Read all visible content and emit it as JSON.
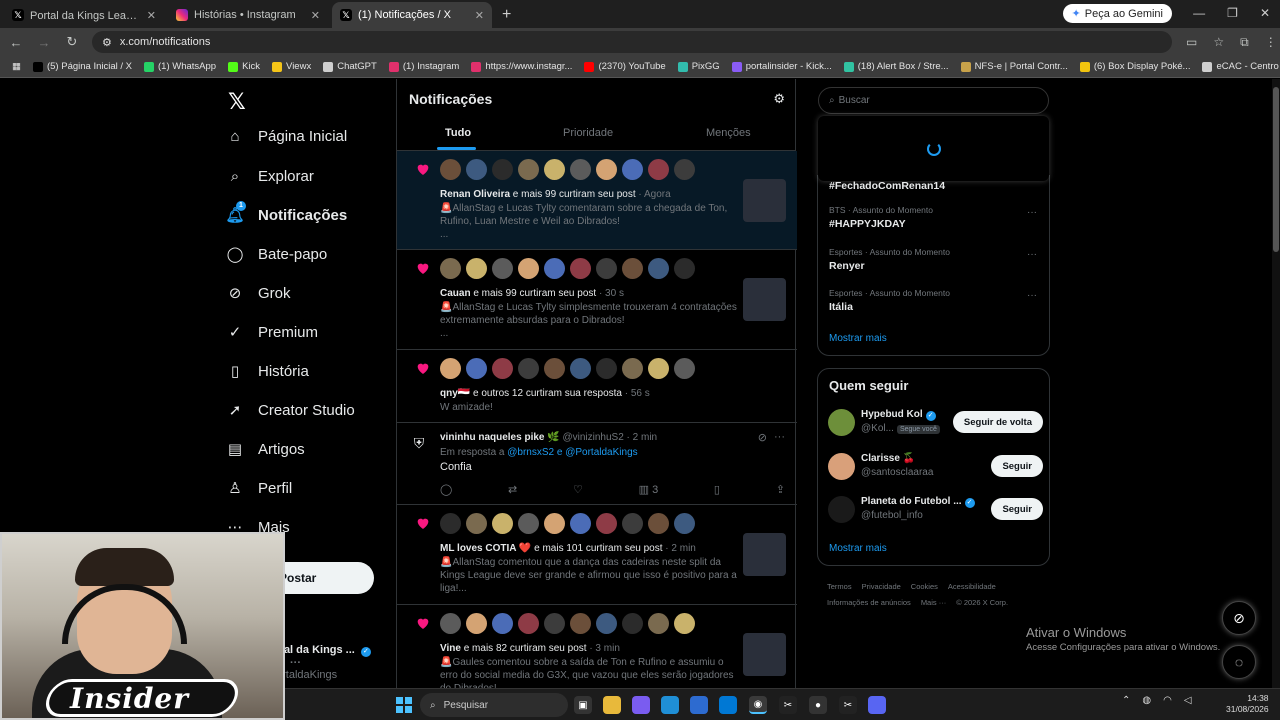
{
  "browser": {
    "tabs": [
      {
        "title": "Portal da Kings League 👑 (@P",
        "icon": "x-icon",
        "active": false
      },
      {
        "title": "Histórias • Instagram",
        "icon": "instagram-icon",
        "active": false
      },
      {
        "title": "(1) Notificações / X",
        "icon": "x-icon",
        "active": true
      }
    ],
    "gemini_label": "Peça ao Gemini",
    "url": "x.com/notifications",
    "bookmarks": [
      {
        "label": "(5) Página Inicial / X",
        "color": "#000000"
      },
      {
        "label": "(1) WhatsApp",
        "color": "#25d366"
      },
      {
        "label": "Kick",
        "color": "#53fc18"
      },
      {
        "label": "Viewx",
        "color": "#f5c518"
      },
      {
        "label": "ChatGPT",
        "color": "#cfcfcf"
      },
      {
        "label": "(1) Instagram",
        "color": "#e1306c"
      },
      {
        "label": "https://www.instagr...",
        "color": "#e1306c"
      },
      {
        "label": "(2370) YouTube",
        "color": "#ff0000"
      },
      {
        "label": "PixGG",
        "color": "#32bcad"
      },
      {
        "label": "portalinsider - Kick...",
        "color": "#8a5cf6"
      },
      {
        "label": "(18) Alert Box / Stre...",
        "color": "#31c3a2"
      },
      {
        "label": "NFS-e | Portal Contr...",
        "color": "#c8a24a"
      },
      {
        "label": "(6) Box Display Poké...",
        "color": "#f1c40f"
      },
      {
        "label": "eCAC - Centro Virtu...",
        "color": "#cfcfcf"
      }
    ]
  },
  "sidebar": {
    "items": [
      {
        "label": "Página Inicial",
        "icon": "home-icon"
      },
      {
        "label": "Explorar",
        "icon": "search-icon"
      },
      {
        "label": "Notificações",
        "icon": "bell-icon",
        "badge": "1"
      },
      {
        "label": "Bate-papo",
        "icon": "chat-icon"
      },
      {
        "label": "Grok",
        "icon": "grok-icon"
      },
      {
        "label": "Premium",
        "icon": "premium-icon"
      },
      {
        "label": "História",
        "icon": "bookmark-icon"
      },
      {
        "label": "Creator Studio",
        "icon": "rocket-icon"
      },
      {
        "label": "Artigos",
        "icon": "article-icon"
      },
      {
        "label": "Perfil",
        "icon": "person-icon"
      },
      {
        "label": "Mais",
        "icon": "more-icon"
      }
    ],
    "post_label": "Postar",
    "account": {
      "name": "rtal da Kings ...",
      "handle": "ortaldaKings"
    }
  },
  "main": {
    "title": "Notificações",
    "tabs": [
      "Tudo",
      "Prioridade",
      "Menções"
    ],
    "notifications": [
      {
        "line_bold": "Renan Oliveira",
        "line_rest": " e mais 99 curtiram seu post",
        "time": " · Agora",
        "text": "🚨AllanStag e Lucas Tylty comentaram sobre a chegada de Ton, Rufino, Luan Mestre e Weil ao Dibrados!",
        "more": "..."
      },
      {
        "line_bold": "Cauan",
        "line_rest": " e mais 99 curtiram seu post",
        "time": " · 30 s",
        "text": "🚨AllanStag e Lucas Tylty simplesmente trouxeram 4 contratações extremamente absurdas para o Dibrados!",
        "more": "..."
      },
      {
        "line_bold": "qny🇾🇪",
        "line_rest": " e outros 12 curtiram sua resposta",
        "time": " · 56 s",
        "text": "W amizade!"
      },
      {
        "reply": true,
        "name": "vininhu naqueles pike 🌿",
        "handle": "@vinizinhuS2 · 2 min",
        "reply_to": "Em resposta a ",
        "mentions": "@brnsxS2 e @PortaldaKings",
        "text": "Confia",
        "views": "3"
      },
      {
        "line_bold": "ML loves COTIA ❤️",
        "line_rest": " e mais 101 curtiram seu post",
        "time": " · 2 min",
        "text": "🚨AllanStag comentou que a dança das cadeiras neste split da Kings League deve ser grande e afirmou que isso é positivo para a liga!..."
      },
      {
        "line_bold": "Vine",
        "line_rest": " e mais 82 curtiram seu post",
        "time": " · 3 min",
        "text": "🚨Gaules comentou sobre a saída de Ton e Rufino e assumiu o erro do social media do G3X, que vazou que eles serão jogadores do Dibrados!"
      }
    ]
  },
  "right": {
    "search_placeholder": "Buscar",
    "trends": [
      {
        "category": "",
        "title": "#FechadoComRenan14"
      },
      {
        "category": "BTS · Assunto do Momento",
        "title": "#HAPPYJKDAY"
      },
      {
        "category": "Esportes · Assunto do Momento",
        "title": "Renyer"
      },
      {
        "category": "Esportes · Assunto do Momento",
        "title": "Itália"
      }
    ],
    "show_more": "Mostrar mais",
    "who_to_follow_title": "Quem seguir",
    "follow": [
      {
        "name": "Hypebud Kol",
        "handle": "@Kol...",
        "badge": "Segue você",
        "button": "Seguir de volta",
        "verified": true
      },
      {
        "name": "Clarisse 🍒",
        "handle": "@santosclaaraa",
        "button": "Seguir",
        "verified": false
      },
      {
        "name": "Planeta do Futebol ...",
        "handle": "@futebol_info",
        "button": "Seguir",
        "verified": true
      }
    ],
    "follow_show_more": "Mostrar mais",
    "footer": [
      "Termos",
      "Privacidade",
      "Cookies",
      "Acessibilidade",
      "Informações de anúncios",
      "Mais ···",
      "© 2026 X Corp."
    ]
  },
  "windows": {
    "activate_title": "Ativar o Windows",
    "activate_sub": "Acesse Configurações para ativar o Windows.",
    "search_placeholder": "Pesquisar",
    "time": "14:38",
    "date": "31/08/2026"
  },
  "overlay": {
    "logo_text": "Insider"
  },
  "colors": {
    "accent": "#1d9bf0",
    "like": "#f91880",
    "background": "#000000",
    "border": "#2f3336"
  }
}
